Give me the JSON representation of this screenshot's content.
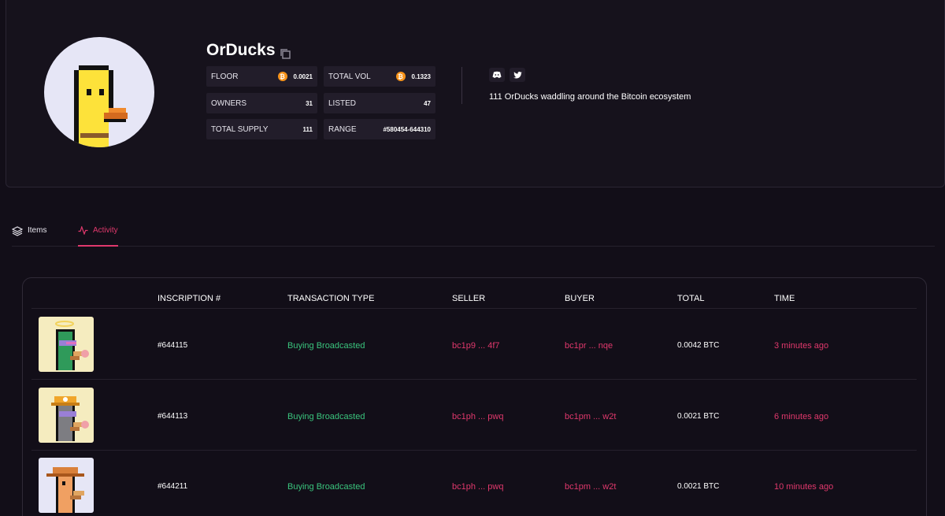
{
  "collection": {
    "name": "OrDucks",
    "description": "111 OrDucks waddling around the Bitcoin ecosystem",
    "stats": {
      "floor_label": "FLOOR",
      "floor_value": "0.0021",
      "total_vol_label": "TOTAL VOL",
      "total_vol_value": "0.1323",
      "owners_label": "OWNERS",
      "owners_value": "31",
      "listed_label": "LISTED",
      "listed_value": "47",
      "total_supply_label": "TOTAL SUPPLY",
      "total_supply_value": "111",
      "range_label": "RANGE",
      "range_value": "#580454-644310"
    },
    "social": [
      "discord-icon",
      "twitter-icon"
    ]
  },
  "tabs": {
    "items": "Items",
    "activity": "Activity",
    "active": "activity"
  },
  "table": {
    "headers": {
      "inscription": "INSCRIPTION #",
      "type": "TRANSACTION TYPE",
      "seller": "SELLER",
      "buyer": "BUYER",
      "total": "TOTAL",
      "time": "TIME"
    },
    "rows": [
      {
        "inscription": "#644115",
        "type": "Buying Broadcasted",
        "seller": "bc1p9 ... 4f7",
        "buyer": "bc1pr ... nqe",
        "total": "0.0042 BTC",
        "time": "3 minutes ago"
      },
      {
        "inscription": "#644113",
        "type": "Buying Broadcasted",
        "seller": "bc1ph ... pwq",
        "buyer": "bc1pm ... w2t",
        "total": "0.0021 BTC",
        "time": "6 minutes ago"
      },
      {
        "inscription": "#644211",
        "type": "Buying Broadcasted",
        "seller": "bc1ph ... pwq",
        "buyer": "bc1pm ... w2t",
        "total": "0.0021 BTC",
        "time": "10 minutes ago"
      }
    ]
  },
  "colors": {
    "background": "#120e18",
    "accent": "#e0386c",
    "success": "#3ac47d",
    "bitcoin": "#f7931a",
    "stat_bg": "#221d2a"
  }
}
